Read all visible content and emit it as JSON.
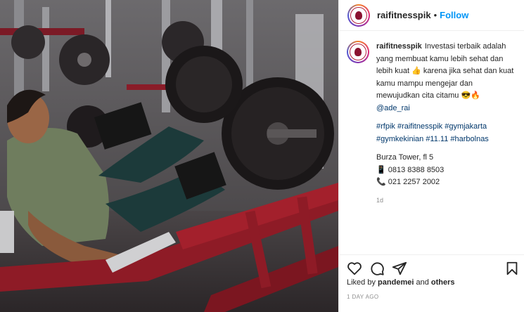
{
  "post": {
    "username": "raifitnesspik",
    "separator": "•",
    "follow_label": "Follow"
  },
  "caption": {
    "username": "raifitnesspik",
    "line1": "Investasi terbaik adalah yang membuat kamu lebih sehat dan lebih kuat",
    "line1_emoji": "👍",
    "line2": "karena jika sehat dan kuat kamu mampu mengejar dan mewujudkan cita citamu",
    "line2_emoji": "😎🔥",
    "mention": "@ade_rai",
    "hashtags": "#rfpik #raifitnesspik #gymjakarta #gymkekinian #11.11 #harbolnas",
    "location": "Burza Tower, fl 5",
    "phone_mobile_icon": "📱",
    "phone_mobile": "0813 8388 8503",
    "phone_landline_icon": "📞",
    "phone_landline": "021 2257 2002",
    "age": "1d"
  },
  "actions": {
    "icons": [
      "heart-icon",
      "comment-icon",
      "share-icon",
      "save-icon"
    ]
  },
  "likes": {
    "prefix": "Liked by",
    "user": "pandemei",
    "conjunction": "and",
    "others": "others"
  },
  "date": "1 DAY AGO",
  "colors": {
    "follow": "#0095f6",
    "link": "#00376b",
    "muted": "#8e8e8e",
    "machine_red": "#8e1b26"
  }
}
